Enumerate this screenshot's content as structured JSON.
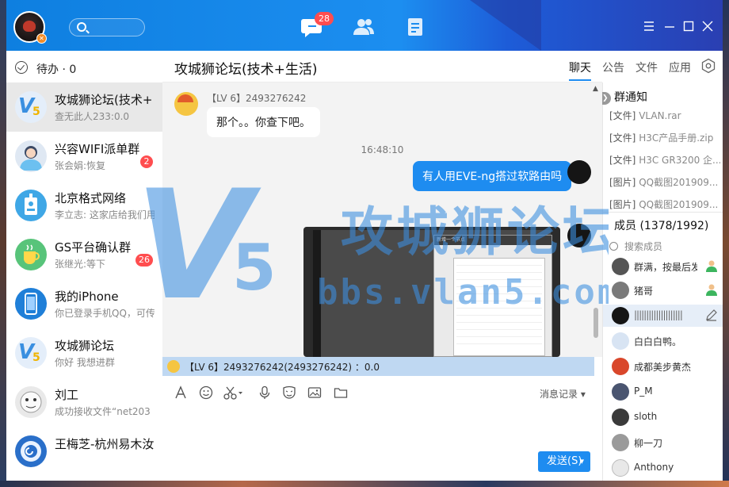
{
  "titlebar": {
    "tab_badge": "28",
    "icons": [
      "search-icon",
      "chat-icon",
      "contacts-icon",
      "docs-icon",
      "menu-icon",
      "minimize-icon",
      "maximize-icon",
      "close-icon"
    ]
  },
  "sidebar": {
    "todo_label": "待办 · 0",
    "conversations": [
      {
        "name": "攻城狮论坛(技术+",
        "last": "查无此人233:0.0",
        "badge": ""
      },
      {
        "name": "兴容WIFI派单群",
        "last": "张会娟:恢复",
        "badge": "2"
      },
      {
        "name": "北京格式网络",
        "last": "李立志: 这家店给我们用",
        "badge": ""
      },
      {
        "name": "GS平台确认群",
        "last": "张继光:等下",
        "badge": "26"
      },
      {
        "name": "我的iPhone",
        "last": "你已登录手机QQ，可传",
        "badge": ""
      },
      {
        "name": "攻城狮论坛",
        "last": "你好 我想进群",
        "badge": ""
      },
      {
        "name": "刘工",
        "last": "成功接收文件“net203",
        "badge": ""
      },
      {
        "name": "王梅芝-杭州易木汝",
        "last": "",
        "badge": ""
      }
    ]
  },
  "chat": {
    "title": "攻城狮论坛(技术+生活)",
    "sender_label": "【LV 6】2493276242",
    "msg_in": "那个。。你查下吧。",
    "time": "16:48:10",
    "msg_out": "有人用EVE-ng搭过软路由吗",
    "image_dialog_title": "新增一个节点",
    "mention": "【LV 6】2493276242(2493276242) ：0.0",
    "history_label": "消息记录",
    "send_label": "发送(S)"
  },
  "right": {
    "tabs": [
      "聊天",
      "公告",
      "文件",
      "应用"
    ],
    "notice_title": "群通知",
    "notices": [
      {
        "tag": "[文件]",
        "text": "VLAN.rar"
      },
      {
        "tag": "[文件]",
        "text": "H3C产品手册.zip"
      },
      {
        "tag": "[文件]",
        "text": "H3C GR3200 企..."
      },
      {
        "tag": "[图片]",
        "text": "QQ截图201909..."
      },
      {
        "tag": "[图片]",
        "text": "QQ截图201909..."
      }
    ],
    "members_title": "成员 (1378/1992)",
    "member_search": "搜索成员",
    "members": [
      {
        "name": "群满，按最后发"
      },
      {
        "name": "猪哥"
      },
      {
        "name": "||||||||||||||||||||"
      },
      {
        "name": "白白白鸭。"
      },
      {
        "name": "成都美步黄杰"
      },
      {
        "name": "P_M"
      },
      {
        "name": "sloth"
      },
      {
        "name": "柳一刀"
      },
      {
        "name": "Anthony"
      }
    ]
  },
  "watermark": {
    "logo": "V",
    "logo_num": "5",
    "cn": "攻城狮论坛",
    "url": "bbs.vlan5.com"
  },
  "colors": {
    "brand": "#1e8cf0",
    "badge": "#ff4d4f"
  }
}
